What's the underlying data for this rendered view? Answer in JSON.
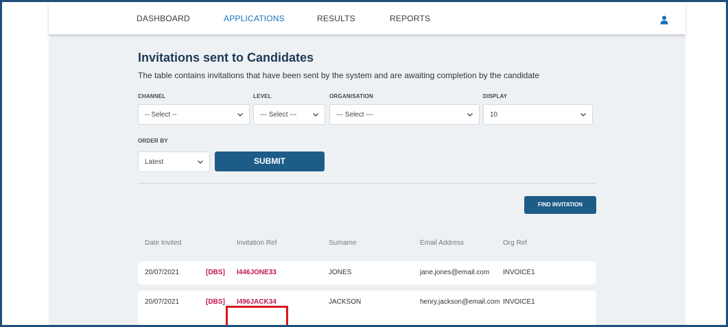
{
  "nav": {
    "items": [
      {
        "label": "DASHBOARD"
      },
      {
        "label": "APPLICATIONS"
      },
      {
        "label": "RESULTS"
      },
      {
        "label": "REPORTS"
      }
    ],
    "active": "APPLICATIONS",
    "user_icon": "user-icon"
  },
  "page": {
    "title": "Invitations sent to Candidates",
    "subtitle": "The table contains invitations that have been sent by the system and are awaiting completion by the candidate"
  },
  "filters": {
    "channel": {
      "label": "CHANNEL",
      "value": "-- Select --"
    },
    "level": {
      "label": "LEVEL",
      "value": "--- Select ---"
    },
    "organisation": {
      "label": "ORGANISATION",
      "value": "--- Select ---"
    },
    "display": {
      "label": "DISPLAY",
      "value": "10"
    },
    "order_by": {
      "label": "ORDER BY",
      "value": "Latest"
    },
    "submit_label": "SUBMIT"
  },
  "find_invitation_label": "FIND INVITATION",
  "table": {
    "headers": [
      "Date Invited",
      "Invitation Ref",
      "Surname",
      "Email Address",
      "Org Ref"
    ],
    "rows": [
      {
        "date": "20/07/2021",
        "tag": "[DBS]",
        "ref": "I446JONE33",
        "surname": "JONES",
        "email": "jane.jones@email.com",
        "org": "INVOICE1"
      },
      {
        "date": "20/07/2021",
        "tag": "[DBS]",
        "ref": "I496JACK34",
        "surname": "JACKSON",
        "email": "henry.jackson@email.com",
        "org": "INVOICE1"
      }
    ]
  },
  "colors": {
    "accent": "#1a73b8",
    "button": "#1d5c86",
    "ref_link": "#c0174f",
    "highlight": "#d9151b",
    "frame": "#1f4f7a"
  }
}
